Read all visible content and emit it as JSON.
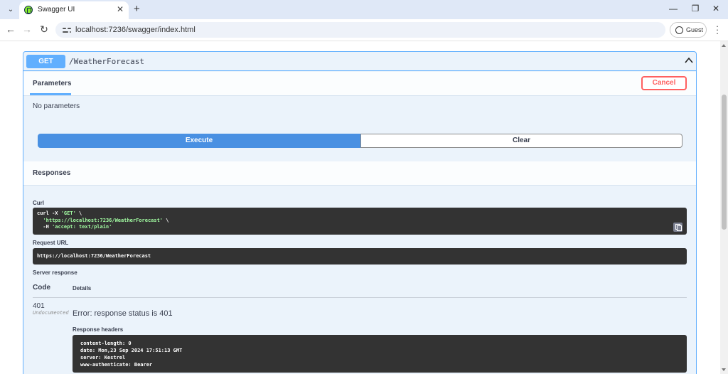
{
  "browser": {
    "tab_title": "Swagger UI",
    "url": "localhost:7236/swagger/index.html",
    "profile_label": "Guest"
  },
  "operation": {
    "method": "GET",
    "path": "/WeatherForecast"
  },
  "parameters": {
    "tab_label": "Parameters",
    "cancel_label": "Cancel",
    "empty_text": "No parameters"
  },
  "actions": {
    "execute_label": "Execute",
    "clear_label": "Clear"
  },
  "responses": {
    "title": "Responses",
    "curl_label": "Curl",
    "curl_lines": [
      {
        "plain": "curl -X ",
        "str": "'GET'",
        "tail": " \\"
      },
      {
        "plain": "  ",
        "str": "'https://localhost:7236/WeatherForecast'",
        "tail": " \\"
      },
      {
        "plain": "  -H ",
        "str": "'accept: text/plain'",
        "tail": ""
      }
    ],
    "request_url_label": "Request URL",
    "request_url": "https://localhost:7236/WeatherForecast",
    "server_response_label": "Server response",
    "col_code": "Code",
    "col_details": "Details",
    "code": "401",
    "code_note": "Undocumented",
    "error": "Error: response status is 401",
    "response_headers_label": "Response headers",
    "headers": [
      "content-length: 0",
      "date: Mon,23 Sep 2024 17:51:13 GMT",
      "server: Kestrel",
      "www-authenticate: Bearer"
    ]
  },
  "colors": {
    "get_blue": "#61affe",
    "execute_blue": "#4990e2",
    "cancel_red": "#ff6060",
    "code_bg": "#333333"
  }
}
